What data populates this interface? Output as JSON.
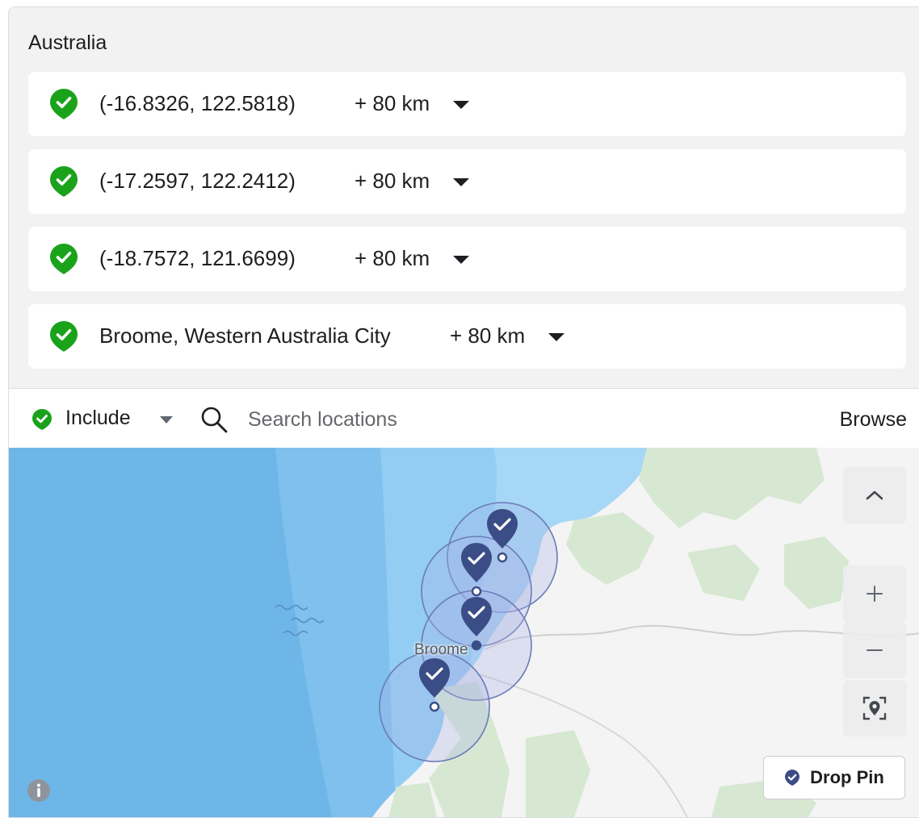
{
  "region": {
    "title": "Australia"
  },
  "locations": [
    {
      "name": "(-16.8326, 122.5818)",
      "radius": "+ 80 km",
      "icon": "green-check-pin-icon"
    },
    {
      "name": "(-17.2597, 122.2412)",
      "radius": "+ 80 km",
      "icon": "green-check-pin-icon"
    },
    {
      "name": "(-18.7572, 121.6699)",
      "radius": "+ 80 km",
      "icon": "green-check-pin-icon"
    },
    {
      "name": "Broome, Western Australia City",
      "radius": "+ 80 km",
      "icon": "green-check-pin-icon"
    }
  ],
  "search": {
    "mode_label": "Include",
    "placeholder": "Search locations",
    "browse_label": "Browse"
  },
  "map": {
    "city_label": "Broome",
    "drop_pin_label": "Drop Pin",
    "controls": [
      "chevron-up-icon",
      "zoom-in-icon",
      "zoom-out-icon",
      "my-location-icon"
    ]
  },
  "colors": {
    "include_green": "#1aa31a",
    "pin_navy": "#3b4d86",
    "water": "#6fb6e8",
    "land": "#f4f4f4",
    "park_green": "#d6e8d2"
  }
}
